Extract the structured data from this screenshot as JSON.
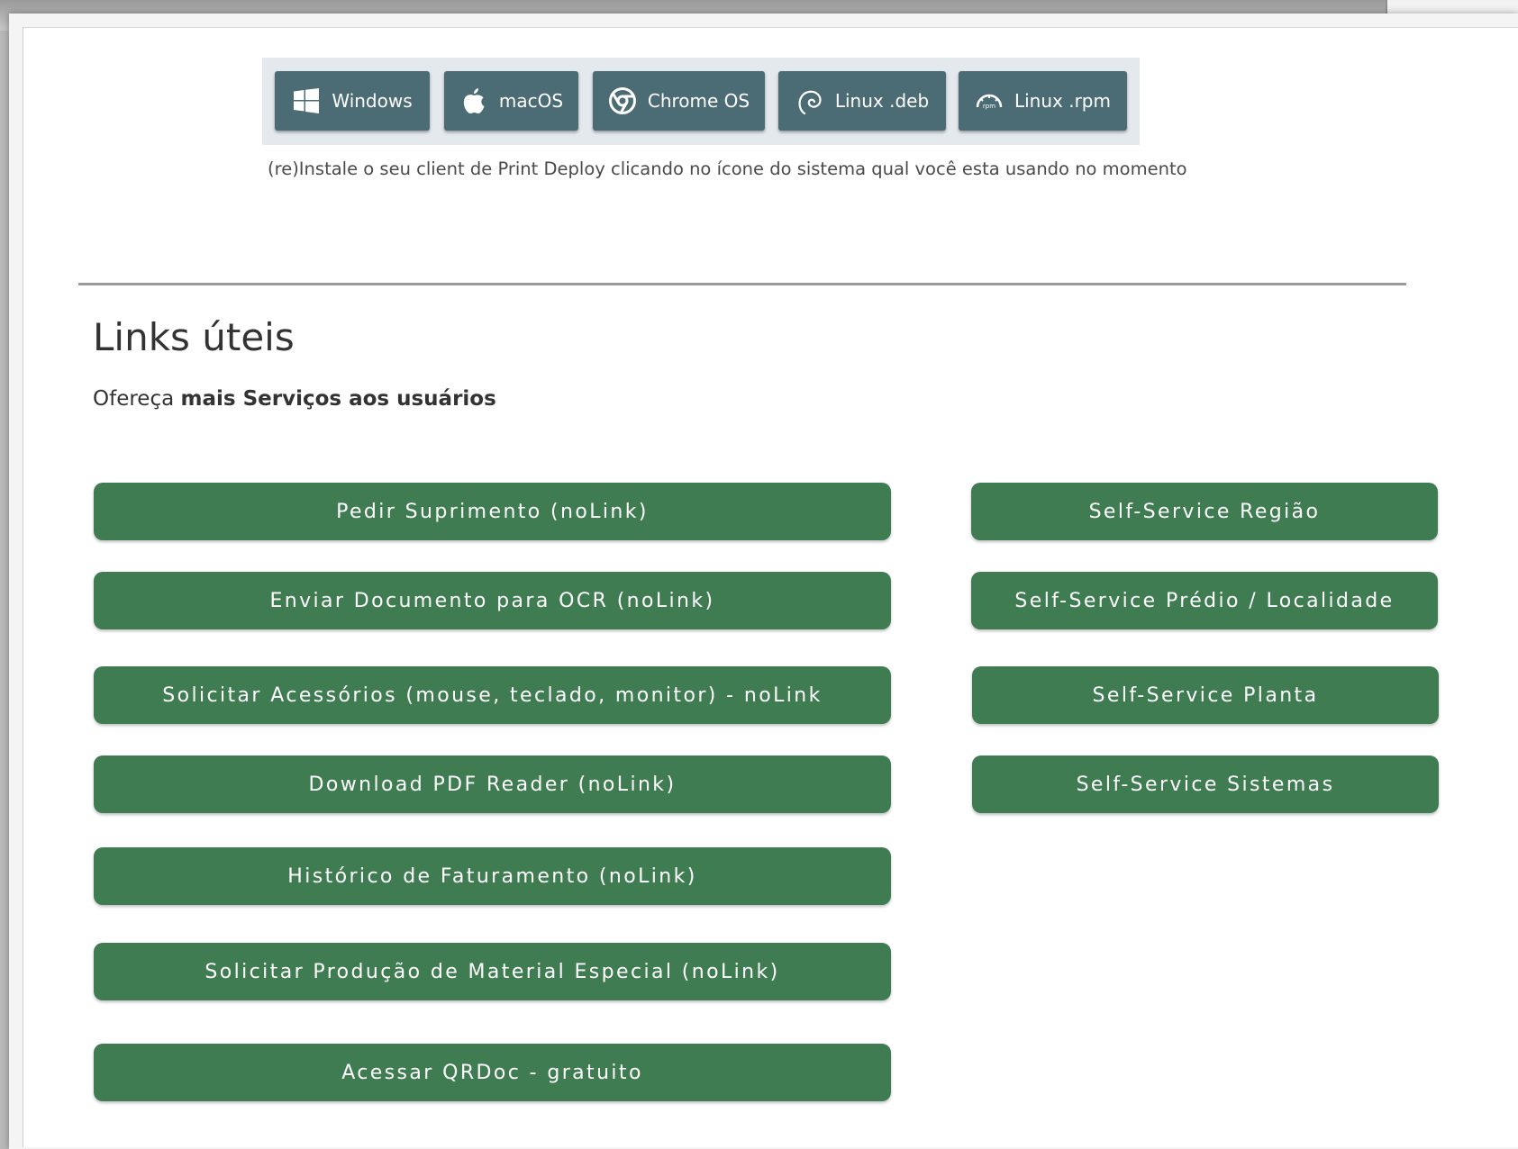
{
  "os_downloads": {
    "buttons": [
      {
        "label": "Windows",
        "icon": "windows-icon"
      },
      {
        "label": "macOS",
        "icon": "apple-icon"
      },
      {
        "label": "Chrome OS",
        "icon": "chrome-icon"
      },
      {
        "label": "Linux .deb",
        "icon": "debian-icon"
      },
      {
        "label": "Linux .rpm",
        "icon": "rpm-icon"
      }
    ],
    "hint": "(re)Instale o seu client de Print Deploy clicando no ícone do sistema qual você esta usando no momento"
  },
  "links": {
    "title": "Links úteis",
    "subtitle_prefix": "Ofereça ",
    "subtitle_bold": "mais Serviços aos usuários",
    "left_buttons": [
      "Pedir Suprimento (noLink)",
      "Enviar Documento para OCR (noLink)",
      "Solicitar Acessórios (mouse, teclado, monitor) - noLink",
      "Download PDF Reader (noLink)",
      "Histórico de Faturamento (noLink)",
      "Solicitar Produção de Material Especial (noLink)",
      "Acessar QRDoc - gratuito"
    ],
    "right_buttons": [
      "Self-Service Região",
      "Self-Service Prédio / Localidade",
      "Self-Service Planta",
      "Self-Service Sistemas"
    ]
  },
  "colors": {
    "os_button": "#4b6c75",
    "os_bar": "#e4e9ee",
    "link_button": "#3f7c52"
  }
}
